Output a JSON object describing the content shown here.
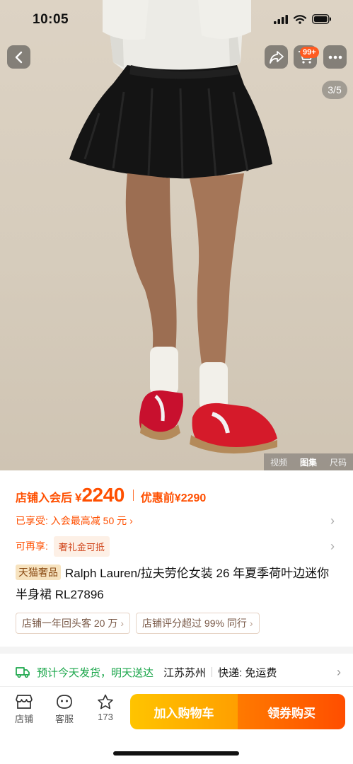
{
  "status": {
    "time": "10:05"
  },
  "header": {
    "cart_badge": "99+",
    "page_indicator": "3/5"
  },
  "media_tabs": [
    "视频",
    "图集",
    "尺码"
  ],
  "price": {
    "prefix": "店铺入会后",
    "currency": "¥",
    "value": "2240",
    "orig_label": "优惠前",
    "orig_price": "¥2290"
  },
  "coupon": {
    "label": "已享受: 入会最高减 50 元",
    "chevron": "›"
  },
  "perk": {
    "label": "可再享:",
    "tag": "奢礼金可抵"
  },
  "product": {
    "tag": "天猫奢品",
    "title": "Ralph Lauren/拉夫劳伦女装 26 年夏季荷叶边迷你半身裙 RL27896"
  },
  "chips": [
    {
      "text": "店铺一年回头客 20 万",
      "chev": "›"
    },
    {
      "text": "店铺评分超过 99% 同行",
      "chev": "›"
    }
  ],
  "shipping": {
    "dispatch": "预计今天发货",
    "arrive": "明天送达",
    "location": "江苏苏州",
    "express": "快递: 免运费"
  },
  "bottom_bar": {
    "shop": "店铺",
    "service": "客服",
    "fav_count": "173",
    "add_cart": "加入购物车",
    "buy": "领券购买"
  },
  "colors": {
    "accent": "#ff4f00",
    "green": "#1aa64a",
    "cart_btn": "#ffb000",
    "buy_btn": "#ff5a00"
  }
}
